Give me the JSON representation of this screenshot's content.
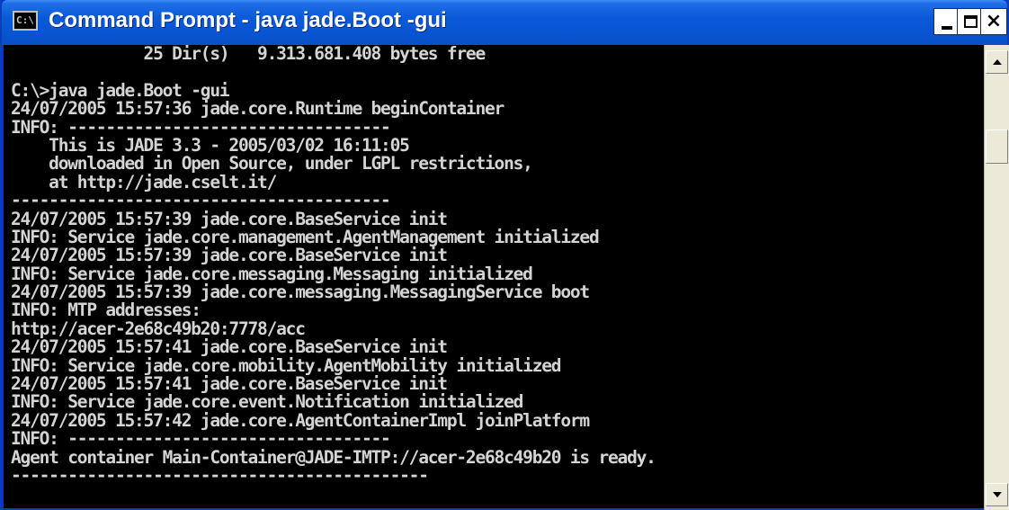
{
  "window": {
    "title": "Command Prompt - java jade.Boot -gui",
    "icon": "console-icon",
    "icon_text": "C:\\",
    "controls": [
      "minimize",
      "maximize",
      "close"
    ],
    "close_label": "×"
  },
  "console": {
    "lines": [
      "              25 Dir(s)   9.313.681.408 bytes free",
      "",
      "C:\\>java jade.Boot -gui",
      "24/07/2005 15:57:36 jade.core.Runtime beginContainer",
      "INFO: ----------------------------------",
      "    This is JADE 3.3 - 2005/03/02 16:11:05",
      "    downloaded in Open Source, under LGPL restrictions,",
      "    at http://jade.cselt.it/",
      "----------------------------------------",
      "24/07/2005 15:57:39 jade.core.BaseService init",
      "INFO: Service jade.core.management.AgentManagement initialized",
      "24/07/2005 15:57:39 jade.core.BaseService init",
      "INFO: Service jade.core.messaging.Messaging initialized",
      "24/07/2005 15:57:39 jade.core.messaging.MessagingService boot",
      "INFO: MTP addresses:",
      "http://acer-2e68c49b20:7778/acc",
      "24/07/2005 15:57:41 jade.core.BaseService init",
      "INFO: Service jade.core.mobility.AgentMobility initialized",
      "24/07/2005 15:57:41 jade.core.BaseService init",
      "INFO: Service jade.core.event.Notification initialized",
      "24/07/2005 15:57:42 jade.core.AgentContainerImpl joinPlatform",
      "INFO: ----------------------------------",
      "Agent container Main-Container@JADE-IMTP://acer-2e68c49b20 is ready.",
      "--------------------------------------------",
      ""
    ]
  },
  "scrollbar": {
    "position": 0.18
  },
  "colors": {
    "titlebar": "#0a5ad8",
    "console_bg": "#000000",
    "console_text": "#d4d4d4"
  }
}
